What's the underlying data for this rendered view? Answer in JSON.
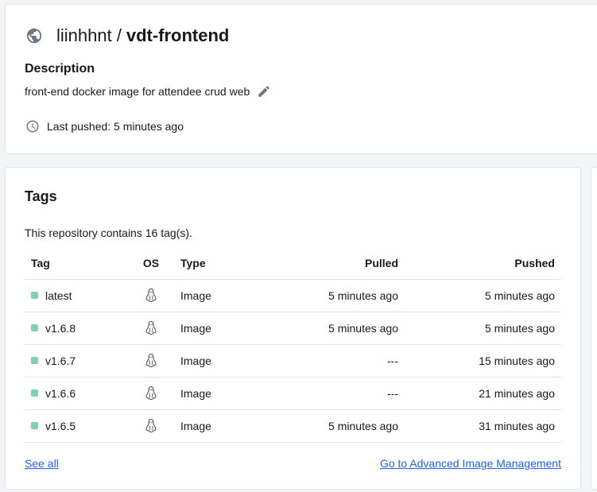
{
  "repo": {
    "namespace": "liinhhnt",
    "separator": "/",
    "name": "vdt-frontend",
    "description_label": "Description",
    "description": "front-end docker image for attendee crud web",
    "last_pushed": "Last pushed: 5 minutes ago"
  },
  "tags": {
    "title": "Tags",
    "count_text": "This repository contains 16 tag(s).",
    "columns": [
      "Tag",
      "OS",
      "Type",
      "Pulled",
      "Pushed"
    ],
    "rows": [
      {
        "tag": "latest",
        "os": "linux-icon",
        "type": "Image",
        "pulled": "5 minutes ago",
        "pushed": "5 minutes ago"
      },
      {
        "tag": "v1.6.8",
        "os": "linux-icon",
        "type": "Image",
        "pulled": "5 minutes ago",
        "pushed": "5 minutes ago"
      },
      {
        "tag": "v1.6.7",
        "os": "linux-icon",
        "type": "Image",
        "pulled": "---",
        "pushed": "15 minutes ago"
      },
      {
        "tag": "v1.6.6",
        "os": "linux-icon",
        "type": "Image",
        "pulled": "---",
        "pushed": "21 minutes ago"
      },
      {
        "tag": "v1.6.5",
        "os": "linux-icon",
        "type": "Image",
        "pulled": "5 minutes ago",
        "pushed": "31 minutes ago"
      }
    ],
    "see_all": "See all",
    "advanced_link": "Go to Advanced Image Management"
  },
  "colors": {
    "accent_link": "#1d63ed",
    "status_dot": "#7dd3b0",
    "icon_gray": "#6c7680"
  }
}
